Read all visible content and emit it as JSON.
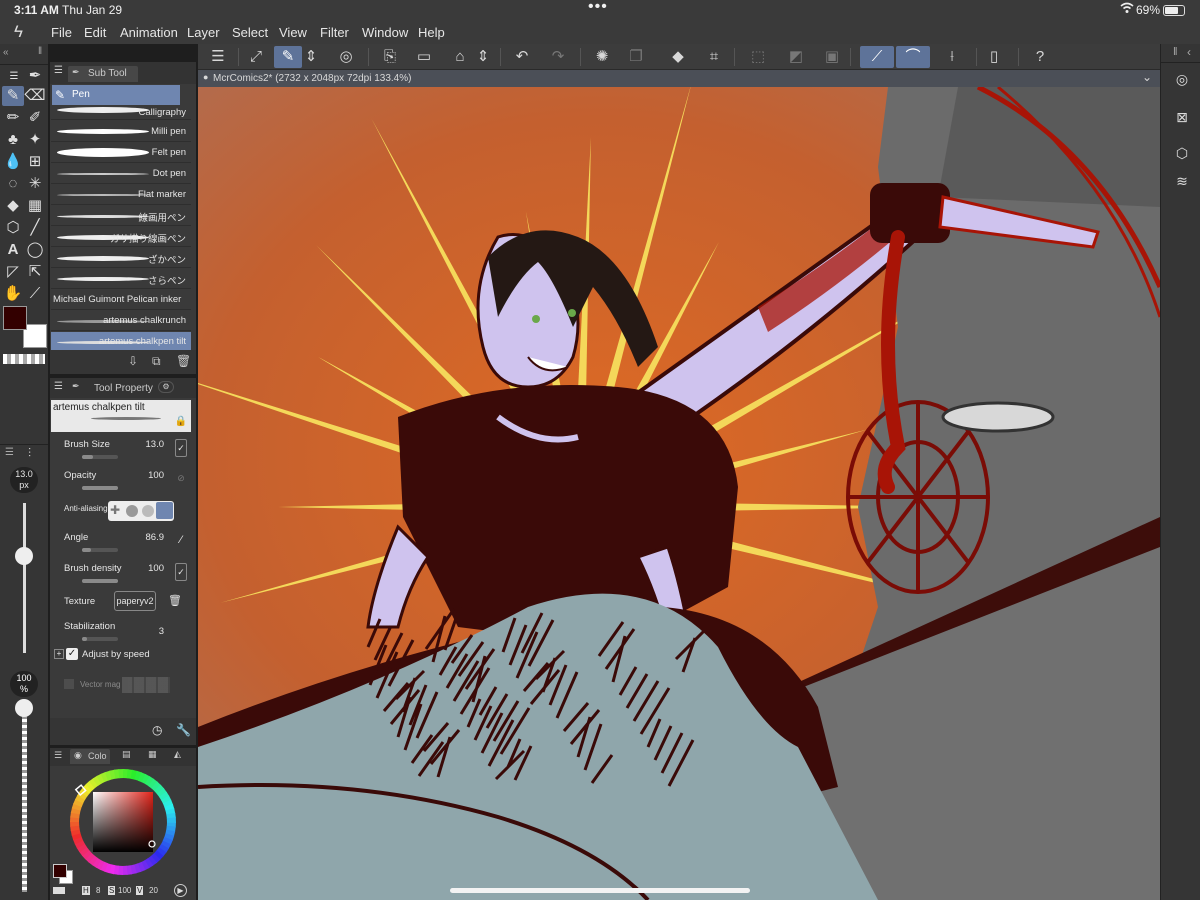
{
  "status_bar": {
    "time": "3:11 AM",
    "date": "Thu Jan 29",
    "battery": "69%"
  },
  "menu": {
    "items": [
      "File",
      "Edit",
      "Animation",
      "Layer",
      "Select",
      "View",
      "Filter",
      "Window",
      "Help"
    ]
  },
  "document": {
    "title": "McrComics2* (2732 x 2048px 72dpi 133.4%)"
  },
  "sub_tool": {
    "panel_title": "Sub Tool",
    "group": "Pen",
    "brushes": [
      "Calligraphy",
      "Milli pen",
      "Felt pen",
      "Dot pen",
      "Flat marker",
      "線画用ペン",
      "ガサ描り線画ペン",
      "ざかペン",
      "さらペン",
      "Michael Guimont Pelican inker",
      "artemus chalkrunch",
      "artemus chalkpen tilt"
    ],
    "selected": "artemus chalkpen tilt"
  },
  "tool_property": {
    "panel_title": "Tool Property",
    "preset_name": "artemus chalkpen tilt",
    "brush_size": {
      "label": "Brush Size",
      "value": "13.0",
      "level": 0.3
    },
    "opacity": {
      "label": "Opacity",
      "value": "100",
      "level": 1.0
    },
    "anti_aliasing": {
      "label": "Anti-aliasing"
    },
    "angle": {
      "label": "Angle",
      "value": "86.9",
      "level": 0.25
    },
    "brush_density": {
      "label": "Brush density",
      "value": "100",
      "level": 1.0
    },
    "texture": {
      "label": "Texture",
      "value": "paperyv2"
    },
    "stabilization": {
      "label": "Stabilization",
      "value": "3",
      "level": 0.15
    },
    "adjust_by_speed": {
      "label": "Adjust by speed",
      "checked": true
    },
    "vector_magnet": {
      "label": "Vector mag"
    }
  },
  "size_slider": {
    "value": "13.0",
    "unit": "px"
  },
  "opacity_slider": {
    "value": "100",
    "unit": "%"
  },
  "color_panel": {
    "tab_label": "Colo",
    "values": {
      "h": "8",
      "s": "100",
      "v": "20"
    },
    "labels": {
      "h": "H",
      "s": "S",
      "v": "V"
    },
    "main_color": "#330000",
    "sub_color": "#ffffff"
  },
  "colors": {
    "accent": "#5e7399",
    "panel": "#3a3a3a",
    "canvas_bg": "#c8622c",
    "ray": "#f4d85a",
    "skin": "#cfc3ee",
    "ink": "#3a0a08",
    "blood": "#a81406",
    "cloth": "#8fa6ab",
    "wall": "#6b6b6b"
  }
}
